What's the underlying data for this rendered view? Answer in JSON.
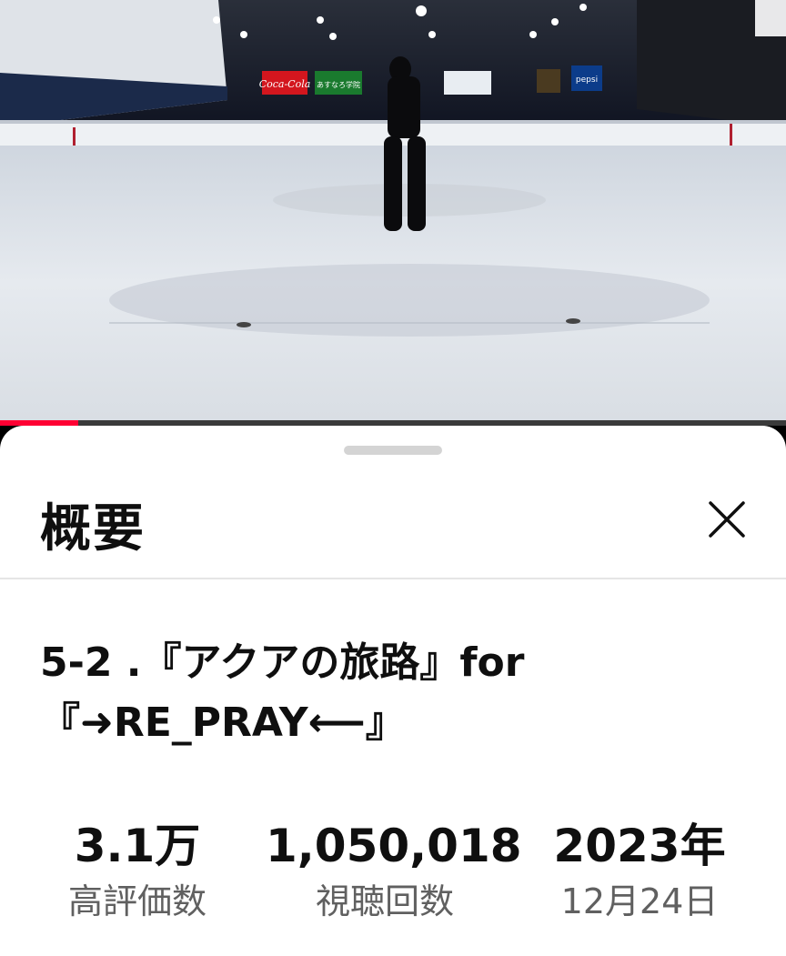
{
  "player": {
    "progress_fraction": 0.1,
    "banners": [
      "Coca-Cola",
      "あすなろ学院",
      "pepsi"
    ]
  },
  "sheet": {
    "title": "概要",
    "video_title": "5-2 .『アクアの旅路』for\n『➜RE_PRAY⟵』",
    "stats": {
      "likes_value": "3.1万",
      "likes_label": "高評価数",
      "views_value": "1,050,018",
      "views_label": "視聴回数",
      "date_value": "2023年",
      "date_label": "12月24日"
    }
  },
  "icons": {
    "close": "close-icon"
  }
}
